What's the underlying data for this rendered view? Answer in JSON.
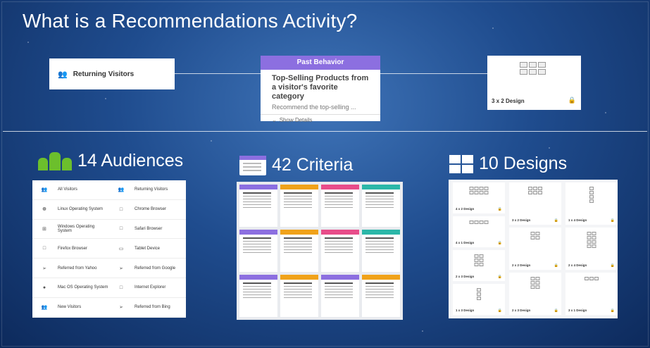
{
  "title": "What is a Recommendations Activity?",
  "audience_card": {
    "label": "Returning Visitors",
    "icon": "people-icon"
  },
  "criteria_card": {
    "header": "Past Behavior",
    "title": "Top-Selling Products from a visitor's favorite category",
    "description": "Recommend the top-selling ...",
    "show_details": "Show Details",
    "header_color": "#8c6fe0"
  },
  "design_card": {
    "label": "3 x 2 Design",
    "icon": "lock-icon"
  },
  "sections": {
    "audiences": {
      "count_label": "14 Audiences",
      "icon_color": "#6cbf2c"
    },
    "criteria": {
      "count_label": "42 Criteria"
    },
    "designs": {
      "count_label": "10 Designs"
    }
  },
  "audience_rows": [
    {
      "left": "All Visitors",
      "left_icon": "people-icon",
      "right": "Returning Visitors",
      "right_icon": "people-icon"
    },
    {
      "left": "Linux Operating System",
      "left_icon": "linux-icon",
      "right": "Chrome Browser",
      "right_icon": "browser-icon"
    },
    {
      "left": "Windows Operating System",
      "left_icon": "windows-icon",
      "right": "Safari Browser",
      "right_icon": "browser-icon"
    },
    {
      "left": "Firefox Browser",
      "left_icon": "browser-icon",
      "right": "Tablet Device",
      "right_icon": "tablet-icon"
    },
    {
      "left": "Referred from Yahoo",
      "left_icon": "referral-icon",
      "right": "Referred from Google",
      "right_icon": "referral-icon"
    },
    {
      "left": "Mac OS Operating System",
      "left_icon": "apple-icon",
      "right": "Internet Explorer",
      "right_icon": "browser-icon"
    },
    {
      "left": "New Visitors",
      "left_icon": "people-icon",
      "right": "Referred from Bing",
      "right_icon": "referral-icon"
    }
  ],
  "criteria_colors": [
    "#8c6fe0",
    "#f0a21a",
    "#e84d8a",
    "#2bb7a8"
  ],
  "design_tiles": [
    [
      "4 x 2 Design",
      "4 x 1 Design",
      "2 x 3 Design",
      "1 x 3 Design"
    ],
    [
      "3 x 2 Design",
      "2 x 2 Design",
      "2 x 3 Design"
    ],
    [
      "1 x 4 Design",
      "2 x 4 Design",
      "3 x 1 Design"
    ]
  ]
}
